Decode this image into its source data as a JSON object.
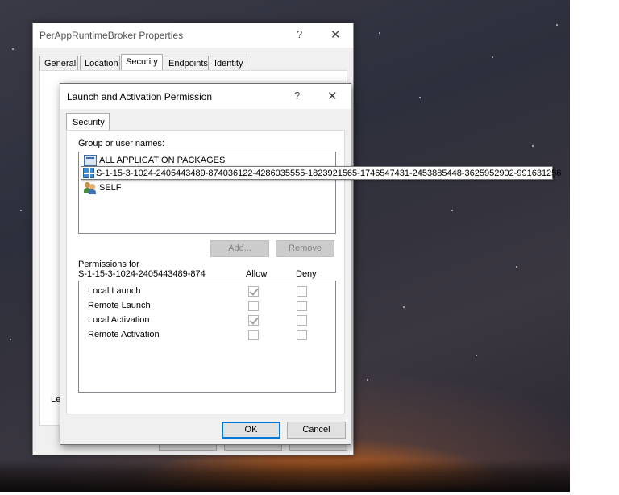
{
  "parent_window": {
    "title": "PerAppRuntimeBroker Properties",
    "help_glyph": "?",
    "close_glyph": "✕",
    "tabs": [
      {
        "label": "General"
      },
      {
        "label": "Location"
      },
      {
        "label": "Security"
      },
      {
        "label": "Endpoints"
      },
      {
        "label": "Identity"
      }
    ],
    "active_tab": "Security",
    "partial_label": "Le"
  },
  "dialog": {
    "title": "Launch and Activation Permission",
    "help_glyph": "?",
    "close_glyph": "✕",
    "tab": "Security",
    "group_label": "Group or user names:",
    "principals": [
      {
        "name": "ALL APPLICATION PACKAGES",
        "icon": "app-package-icon"
      },
      {
        "name": "S-1-15-3-1024-2405443489-874036122-4286035555-1823921565-1746547431-2453885448-3625952902-991631256",
        "icon": "app-sid-icon"
      },
      {
        "name": "SELF",
        "icon": "users-icon"
      }
    ],
    "tooltip_text": "S-1-15-3-1024-2405443489-874036122-4286035555-1823921565-1746547431-2453885448-3625952902-991631256",
    "add_button": "Add...",
    "remove_button": "Remove",
    "permissions_label": "Permissions for",
    "permissions_for": "S-1-15-3-1024-2405443489-8740",
    "allow_header": "Allow",
    "deny_header": "Deny",
    "permissions": [
      {
        "name": "Local Launch",
        "allow": true,
        "deny": false
      },
      {
        "name": "Remote Launch",
        "allow": false,
        "deny": false
      },
      {
        "name": "Local Activation",
        "allow": true,
        "deny": false
      },
      {
        "name": "Remote Activation",
        "allow": false,
        "deny": false
      }
    ],
    "ok_button": "OK",
    "cancel_button": "Cancel"
  },
  "colors": {
    "dialog_bg": "#f0f0f0",
    "focus_accent": "#0078d7",
    "sky_glow": "#e07a22"
  }
}
